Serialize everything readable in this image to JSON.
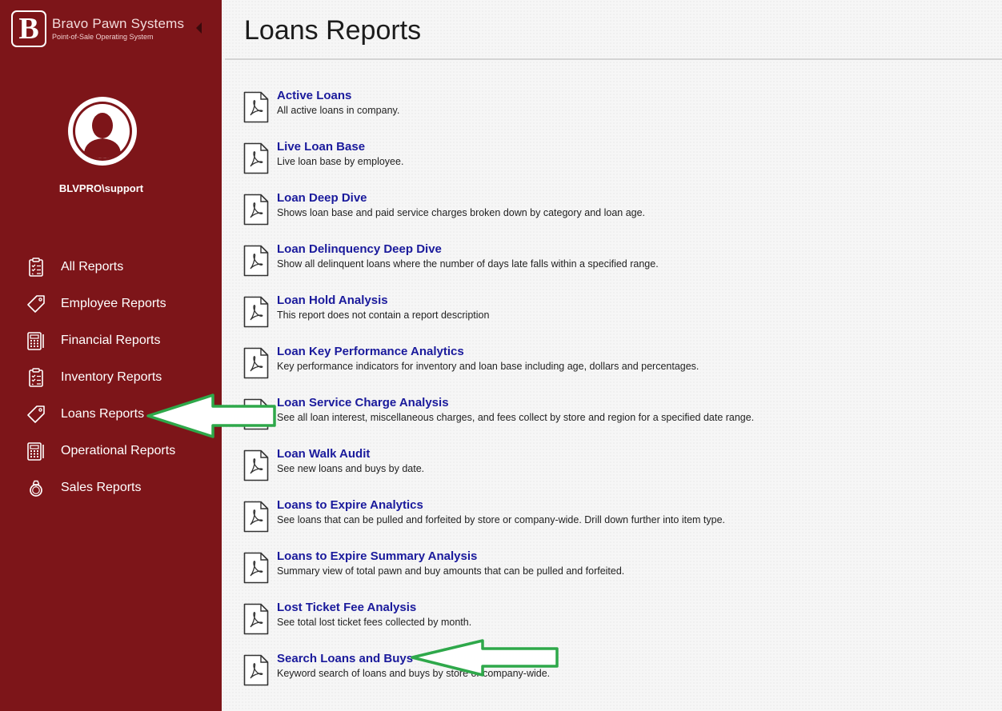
{
  "brand": {
    "name": "Bravo Pawn Systems",
    "tagline": "Point-of-Sale Operating System",
    "logo_letter": "B"
  },
  "user": {
    "name": "BLVPRO\\support"
  },
  "nav": {
    "items": [
      {
        "label": "All Reports",
        "icon": "clipboard-icon"
      },
      {
        "label": "Employee Reports",
        "icon": "tag-icon"
      },
      {
        "label": "Financial Reports",
        "icon": "calculator-icon"
      },
      {
        "label": "Inventory Reports",
        "icon": "clipboard-icon"
      },
      {
        "label": "Loans Reports",
        "icon": "tag-icon"
      },
      {
        "label": "Operational Reports",
        "icon": "calculator-icon"
      },
      {
        "label": "Sales Reports",
        "icon": "ring-icon"
      }
    ]
  },
  "page": {
    "title": "Loans Reports"
  },
  "reports": [
    {
      "name": "Active Loans",
      "description": "All active loans in company."
    },
    {
      "name": "Live Loan Base",
      "description": "Live loan base by employee."
    },
    {
      "name": "Loan Deep Dive",
      "description": "Shows loan base and paid service charges broken down by category and loan age."
    },
    {
      "name": "Loan Delinquency Deep Dive",
      "description": "Show all delinquent loans where the number of days late falls within a specified range."
    },
    {
      "name": "Loan Hold Analysis",
      "description": "This report does not contain a report description"
    },
    {
      "name": "Loan Key Performance Analytics",
      "description": "Key performance indicators for inventory and loan base including age, dollars and percentages."
    },
    {
      "name": "Loan Service Charge Analysis",
      "description": "See all loan interest, miscellaneous charges, and fees collect by store and region for a specified date range."
    },
    {
      "name": "Loan Walk Audit",
      "description": "See new loans and buys by date."
    },
    {
      "name": "Loans to Expire Analytics",
      "description": "See loans that can be pulled and forfeited by store or company-wide. Drill down further into item type."
    },
    {
      "name": "Loans to Expire Summary Analysis",
      "description": "Summary view of total pawn and buy amounts that can be pulled and forfeited."
    },
    {
      "name": "Lost Ticket Fee Analysis",
      "description": "See total lost ticket fees collected by month."
    },
    {
      "name": "Search Loans and Buys",
      "description": "Keyword search of loans and buys by store or company-wide."
    }
  ],
  "colors": {
    "sidebar": "#7d1519",
    "link": "#1a1a9c",
    "arrow": "#2ea84a"
  }
}
